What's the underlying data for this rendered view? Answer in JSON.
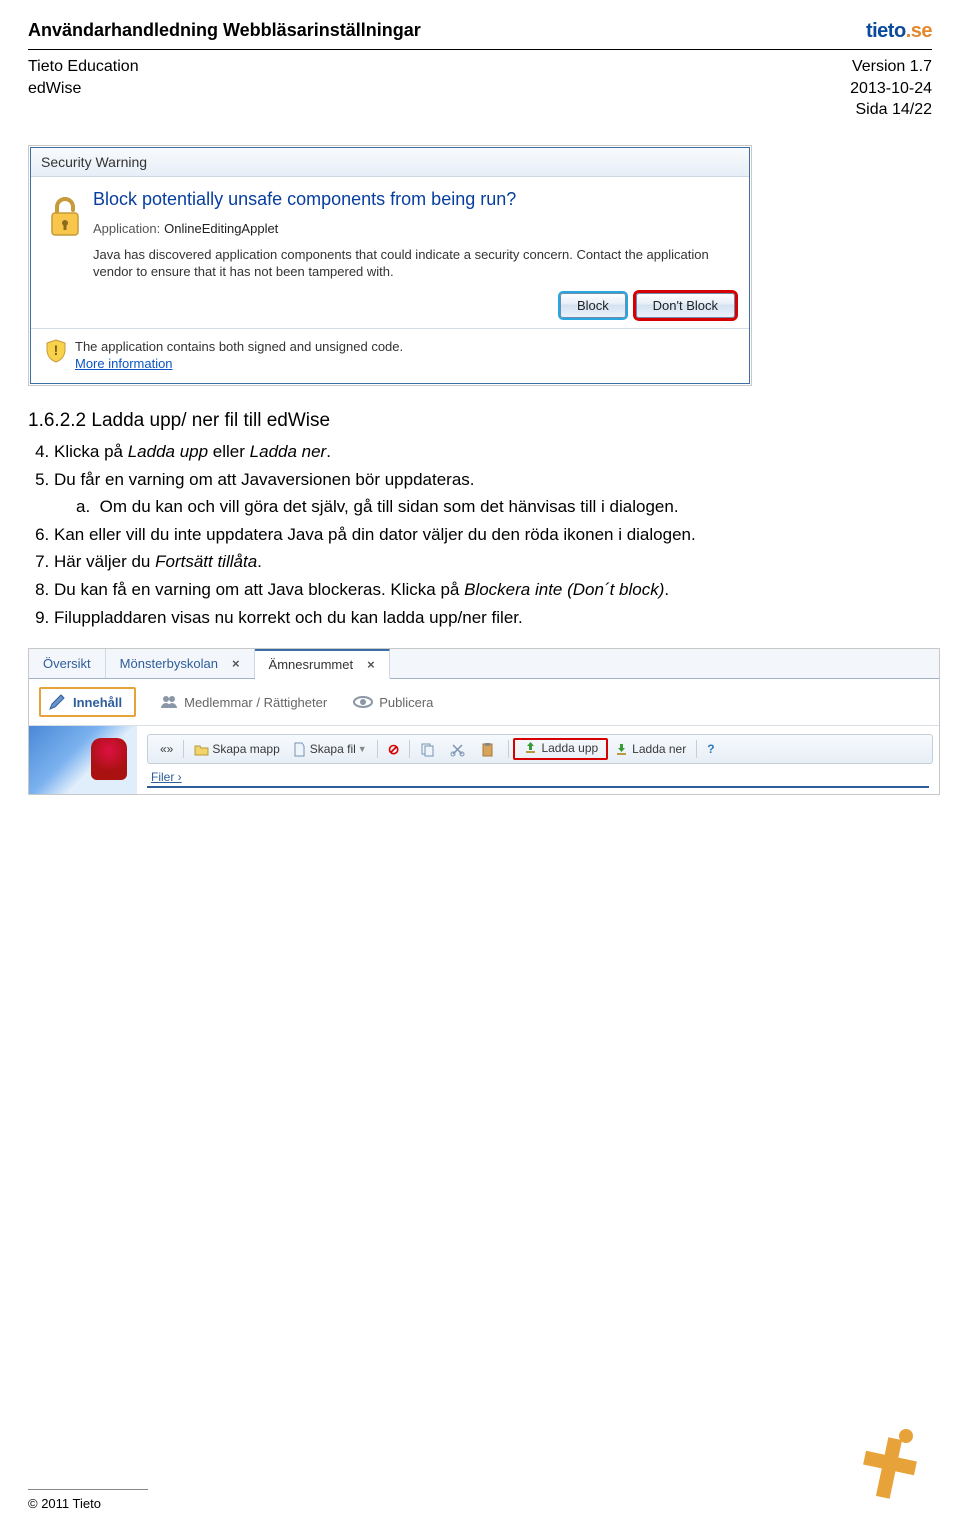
{
  "header": {
    "title": "Användarhandledning Webbläsarinställningar",
    "org": "Tieto Education",
    "product": "edWise",
    "logo_text_blue": "tieto",
    "logo_text_orange": ".se",
    "version": "Version 1.7",
    "date": "2013-10-24",
    "page": "Sida 14/22"
  },
  "dialog": {
    "title": "Security Warning",
    "question": "Block potentially unsafe components from being run?",
    "app_label": "Application:",
    "app_name": "OnlineEditingApplet",
    "description": "Java has discovered application components that could indicate a security concern. Contact the application vendor to ensure that it has not been tampered with.",
    "btn_block": "Block",
    "btn_dont_block": "Don't Block",
    "warn_text": "The application contains both signed and unsigned code.",
    "more_link": "More information"
  },
  "section": {
    "heading": "1.6.2.2 Ladda upp/ ner fil till edWise",
    "items": {
      "4": "Klicka på Ladda upp eller Ladda ner.",
      "5": "Du får en varning om att Javaversionen bör uppdateras.",
      "5a_prefix": "a.",
      "5a": "Om du kan och vill göra det själv, gå till sidan som det hänvisas till i dialogen.",
      "6": "Kan eller vill du inte uppdatera Java på din dator väljer du den röda ikonen i dialogen.",
      "7": "Här väljer du Fortsätt tillåta.",
      "8": "Du kan få en varning om att Java blockeras. Klicka på Blockera inte (Don´t block).",
      "9": "Filuppladdaren visas nu korrekt och du kan ladda upp/ner filer."
    },
    "emphasis": {
      "ladda_upp": "Ladda upp",
      "ladda_ner": "Ladda ner",
      "fortsatt": "Fortsätt tillåta",
      "blockera": "Blockera inte (Don´t block)"
    }
  },
  "edwise": {
    "tabs": {
      "overview": "Översikt",
      "school": "Mönsterbyskolan",
      "subject": "Ämnesrummet"
    },
    "subtabs": {
      "content": "Innehåll",
      "members": "Medlemmar / Rättigheter",
      "publish": "Publicera"
    },
    "toolbar": {
      "nav": "«»",
      "skapa_mapp": "Skapa mapp",
      "skapa_fil": "Skapa fil",
      "ladda_upp": "Ladda upp",
      "ladda_ner": "Ladda ner",
      "help": "?"
    },
    "breadcrumb": "Filer ›"
  },
  "footer": {
    "copyright": "© 2011 Tieto"
  }
}
